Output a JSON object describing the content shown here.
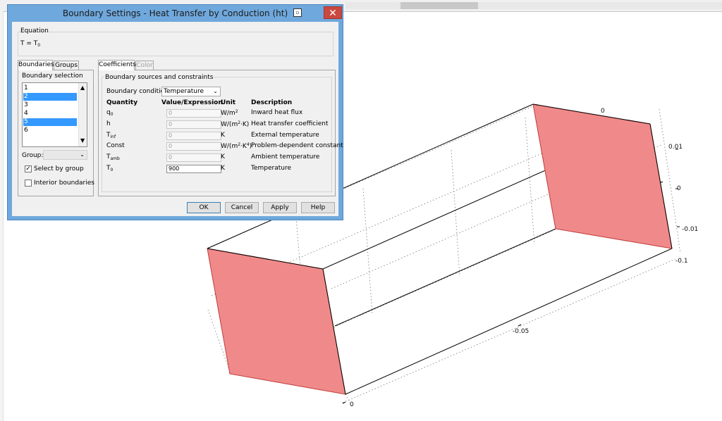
{
  "dialog": {
    "title": "Boundary Settings - Heat Transfer by Conduction (ht)",
    "close_glyph": "✕",
    "equation": {
      "label": "Equation",
      "text": "T = T",
      "sub": "0"
    },
    "left_tabs": [
      "Boundaries",
      "Groups"
    ],
    "boundary_selection": {
      "label": "Boundary selection",
      "items": [
        "1",
        "2",
        "3",
        "4",
        "5",
        "6"
      ],
      "selected": [
        "2",
        "5"
      ]
    },
    "group": {
      "label": "Group:",
      "value": ""
    },
    "select_by_group": {
      "label": "Select by group",
      "checked": true
    },
    "interior_boundaries": {
      "label": "Interior boundaries",
      "checked": false
    },
    "right_tabs": [
      "Coefficients",
      "Color"
    ],
    "sources_label": "Boundary sources and constraints",
    "boundary_condition": {
      "label": "Boundary condition:",
      "value": "Temperature"
    },
    "table": {
      "headers": [
        "Quantity",
        "Value/Expression",
        "Unit",
        "Description"
      ],
      "rows": [
        {
          "q": "q",
          "q_sub": "0",
          "value": "0",
          "unit": "W/m",
          "unit_sup": "2",
          "unit_tail": "",
          "desc": "Inward heat flux",
          "active": false
        },
        {
          "q": "h",
          "q_sub": "",
          "value": "0",
          "unit": "W/(m",
          "unit_sup": "2",
          "unit_tail": "·K)",
          "desc": "Heat transfer coefficient",
          "active": false
        },
        {
          "q": "T",
          "q_sub": "inf",
          "value": "0",
          "unit": "K",
          "unit_sup": "",
          "unit_tail": "",
          "desc": "External temperature",
          "active": false
        },
        {
          "q": "Const",
          "q_sub": "",
          "value": "0",
          "unit": "W/(m",
          "unit_sup": "2",
          "unit_tail": "·K",
          "unit_sup2": "4",
          "unit_tail2": ")",
          "desc": "Problem-dependent constant",
          "active": false
        },
        {
          "q": "T",
          "q_sub": "amb",
          "value": "0",
          "unit": "K",
          "unit_sup": "",
          "unit_tail": "",
          "desc": "Ambient temperature",
          "active": false
        },
        {
          "q": "T",
          "q_sub": "0",
          "value": "900",
          "unit": "K",
          "unit_sup": "",
          "unit_tail": "",
          "desc": "Temperature",
          "active": true
        }
      ]
    },
    "buttons": {
      "ok": "OK",
      "cancel": "Cancel",
      "apply": "Apply",
      "help": "Help"
    }
  },
  "plot": {
    "face_color": "#f08a8a",
    "axis_labels": {
      "top_zero": "0",
      "right_pos": "0.01",
      "right_zero": "0",
      "right_neg": "-0.01",
      "right_far": "-0.1",
      "mid_x": "-0.05",
      "bottom_zero": "0"
    }
  }
}
